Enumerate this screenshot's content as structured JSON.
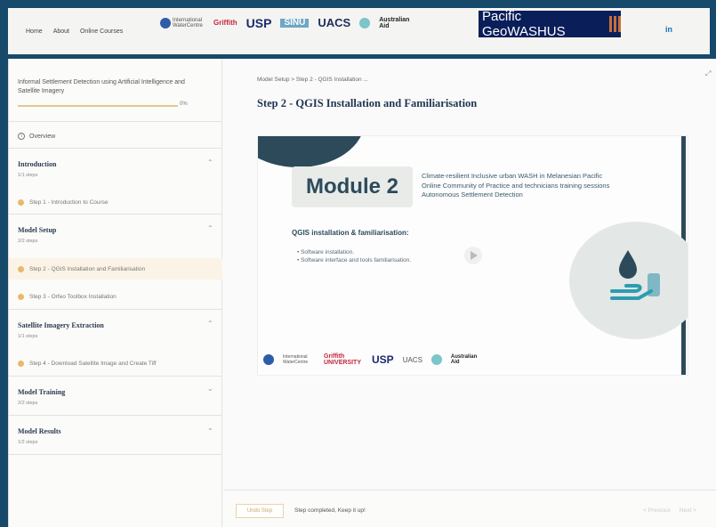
{
  "nav": {
    "home": "Home",
    "about": "About",
    "courses": "Online Courses",
    "linkedin": "in"
  },
  "header_logos": {
    "iwc": "International WaterCentre",
    "griffith": "Griffith",
    "usp": "USP",
    "sinu": "SINU",
    "uacs": "UACS",
    "aid": "Australian Aid",
    "brand": "Pacific GeoWASHUS"
  },
  "sidebar": {
    "course_title": "Informal Settlement Detection using Artificial Intelligence and Satellite Imagery",
    "progress_pct": "0%",
    "progress_value": 0,
    "overview": "Overview",
    "sections": [
      {
        "title": "Introduction",
        "steps": "1/1 steps",
        "items": [
          "Step 1 - Introduction to Course"
        ]
      },
      {
        "title": "Model Setup",
        "steps": "2/2 steps",
        "items": [
          "Step 2 - QGIS Installation and Familiarisation",
          "Step 3 - Orfeo Toolbox Installation"
        ]
      },
      {
        "title": "Satellite Imagery Extraction",
        "steps": "1/1 steps",
        "items": [
          "Step 4 - Download Satellite Image and Create Tiff"
        ]
      },
      {
        "title": "Model Training",
        "steps": "2/2 steps"
      },
      {
        "title": "Model Results",
        "steps": "1/2 steps"
      }
    ]
  },
  "content": {
    "breadcrumb": "Model Setup  >  Step 2 - QGIS Installation ...",
    "title": "Step 2 - QGIS Installation and Familiarisation",
    "video": {
      "module": "Module 2",
      "subtitle_1": "Climate-resilient Inclusive urban WASH in Melanesian Pacific",
      "subtitle_2": "Online Community of Practice and technicians training sessions",
      "subtitle_3": "Autonomous Settlement Detection",
      "heading": "QGIS installation & familiarisation:",
      "bullet_1": "• Software installation.",
      "bullet_2": "• Software interface and tools familiarisation.",
      "logo_iwc": "International WaterCentre",
      "logo_griffith": "Griffith UNIVERSITY",
      "logo_usp": "USP",
      "logo_uacs": "UACS",
      "logo_aid": "Australian Aid"
    }
  },
  "footer": {
    "undo": "Undo Step",
    "status": "Step completed, Keep it up!",
    "previous": "< Previous",
    "next": "Next >"
  },
  "colors": {
    "frame_bg": "#17496a",
    "accent": "#e9b96a",
    "teal": "#2d4a5a"
  }
}
